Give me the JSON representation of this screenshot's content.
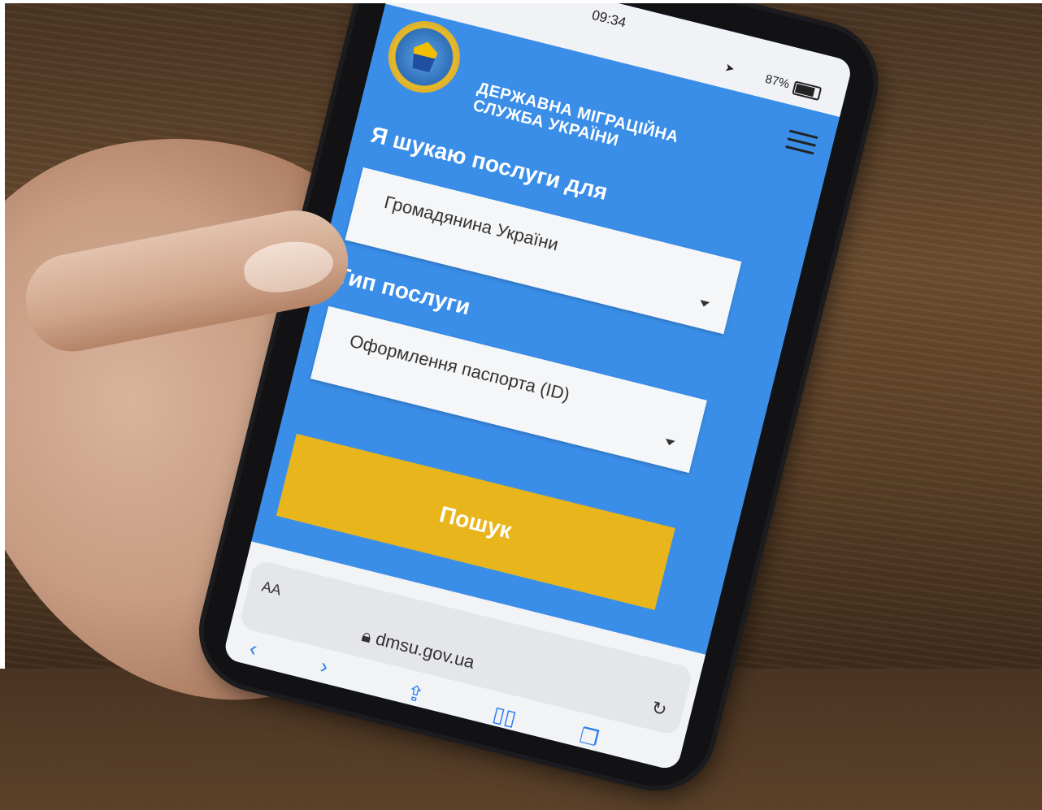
{
  "status_bar": {
    "time": "09:34",
    "battery": "87%"
  },
  "site": {
    "agency_name": "ДЕРЖАВНА МІГРАЦІЙНА СЛУЖБА УКРАЇНИ",
    "search_for_label": "Я шукаю послуги для",
    "search_for_value": "Громадянина України",
    "service_type_label": "Тип послуги",
    "service_type_value": "Оформлення паспорта (ID)",
    "search_button": "Пошук"
  },
  "browser": {
    "aa": "AA",
    "url": "dmsu.gov.ua"
  },
  "icons": {
    "menu": "hamburger-icon",
    "emblem": "coat-of-arms-emblem",
    "back": "chevron-left-icon",
    "forward": "chevron-right-icon",
    "share": "share-icon",
    "bookmarks": "book-icon",
    "tabs": "tabs-icon",
    "reload": "reload-icon",
    "lock": "lock-icon"
  },
  "colors": {
    "site_blue": "#3a8ee8",
    "button_yellow": "#e8b61c"
  }
}
